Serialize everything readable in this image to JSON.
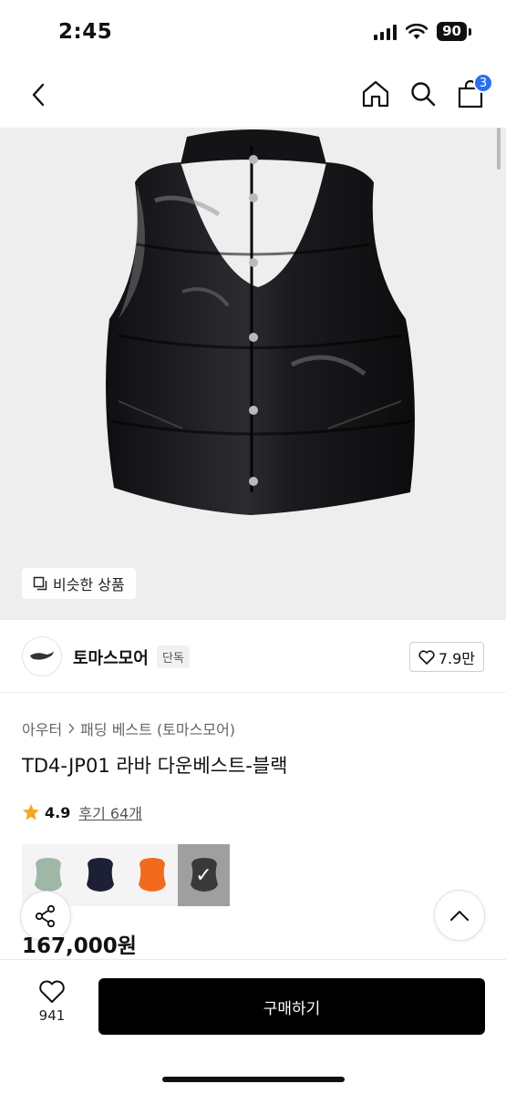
{
  "status_bar": {
    "time": "2:45",
    "battery": "90"
  },
  "nav": {
    "cart_count": "3"
  },
  "hero": {
    "similar_label": "비슷한 상품"
  },
  "brand": {
    "name": "토마스모어",
    "badge": "단독",
    "likes": "7.9만"
  },
  "breadcrumb": {
    "category": "아우터",
    "subcategory": "패딩 베스트 (토마스모어)"
  },
  "product": {
    "title": "TD4-JP01 라바 다운베스트-블랙",
    "rating": "4.9",
    "reviews": "후기 64개",
    "price": "167,000원"
  },
  "swatches": [
    {
      "name": "mint",
      "color": "#9fb7a6"
    },
    {
      "name": "navy",
      "color": "#1d2035"
    },
    {
      "name": "orange",
      "color": "#f26b1d"
    },
    {
      "name": "black",
      "color": "#121212",
      "selected": true
    }
  ],
  "bottom": {
    "wish_count": "941",
    "buy_label": "구매하기"
  },
  "colors": {
    "accent": "#2b6ef0",
    "star": "#f5a623",
    "buy": "#000000"
  }
}
